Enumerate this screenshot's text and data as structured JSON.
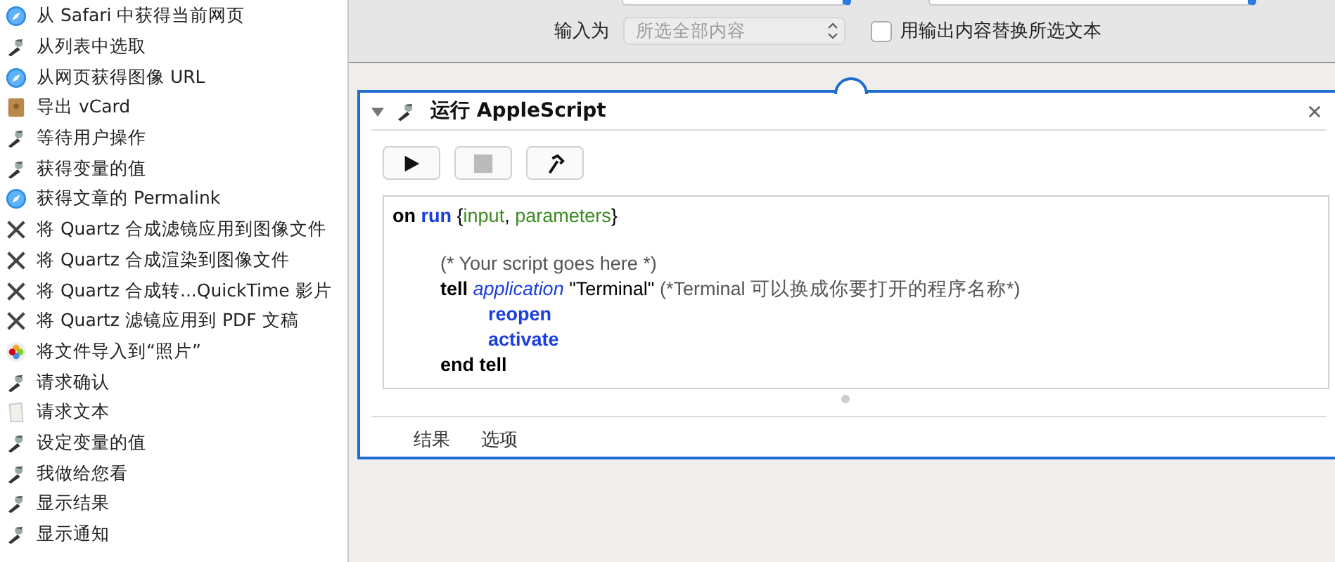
{
  "sidebar": {
    "items": [
      {
        "label": "从 Safari 中获得当前网页",
        "kind": "safari"
      },
      {
        "label": "从列表中选取",
        "kind": "automator"
      },
      {
        "label": "从网页获得图像 URL",
        "kind": "safari"
      },
      {
        "label": "导出 vCard",
        "kind": "contacts"
      },
      {
        "label": "等待用户操作",
        "kind": "automator"
      },
      {
        "label": "获得变量的值",
        "kind": "automator"
      },
      {
        "label": "获得文章的 Permalink",
        "kind": "safari"
      },
      {
        "label": "将 Quartz 合成滤镜应用到图像文件",
        "kind": "quartz"
      },
      {
        "label": "将 Quartz 合成渲染到图像文件",
        "kind": "quartz"
      },
      {
        "label": "将 Quartz 合成转...QuickTime 影片",
        "kind": "quartz"
      },
      {
        "label": "将 Quartz 滤镜应用到 PDF 文稿",
        "kind": "quartz"
      },
      {
        "label": "将文件导入到“照片”",
        "kind": "photos"
      },
      {
        "label": "请求确认",
        "kind": "automator"
      },
      {
        "label": "请求文本",
        "kind": "textedit"
      },
      {
        "label": "设定变量的值",
        "kind": "automator"
      },
      {
        "label": "我做给您看",
        "kind": "automator"
      },
      {
        "label": "显示结果",
        "kind": "automator"
      },
      {
        "label": "显示通知",
        "kind": "automator"
      }
    ]
  },
  "input_options": {
    "label": "输入为",
    "select": {
      "value": "所选全部内容",
      "disabled": true
    },
    "checkbox": {
      "label": "用输出内容替换所选文本",
      "checked": false
    }
  },
  "action": {
    "title": "运行 AppleScript",
    "expanded": true,
    "toolbar": [
      {
        "kind": "run",
        "disabled": false
      },
      {
        "kind": "stop",
        "disabled": true
      },
      {
        "kind": "compile",
        "disabled": false
      }
    ],
    "code": [
      {
        "tokens": [
          {
            "text": "on",
            "kind": "keyword"
          },
          {
            "text": "run",
            "kind": "command"
          },
          {
            "text": "{",
            "kind": "plain"
          },
          {
            "text": "input",
            "kind": "variable"
          },
          {
            "text": ",",
            "kind": "plain"
          },
          {
            "text": "parameters",
            "kind": "variable"
          },
          {
            "text": "}",
            "kind": "plain"
          }
        ],
        "children": [
          {
            "tokens": [
              {
                "text": "(* Your script goes here *)",
                "kind": "comment"
              }
            ]
          },
          {
            "tokens": [
              {
                "text": "tell",
                "kind": "keyword"
              },
              {
                "text": "application",
                "kind": "class"
              },
              {
                "text": "\"Terminal\"",
                "kind": "plain"
              },
              {
                "text": "(*Terminal 可以换成你要打开的程序名称*)",
                "kind": "comment"
              }
            ],
            "children": [
              {
                "tokens": [
                  {
                    "text": "reopen",
                    "kind": "command"
                  }
                ]
              },
              {
                "tokens": [
                  {
                    "text": "activate",
                    "kind": "command"
                  }
                ]
              }
            ]
          },
          {
            "tokens": [
              {
                "text": "end tell",
                "kind": "keyword"
              }
            ]
          }
        ]
      }
    ],
    "tabs": [
      {
        "label": "结果",
        "selected": false
      },
      {
        "label": "选项",
        "selected": false
      }
    ]
  }
}
